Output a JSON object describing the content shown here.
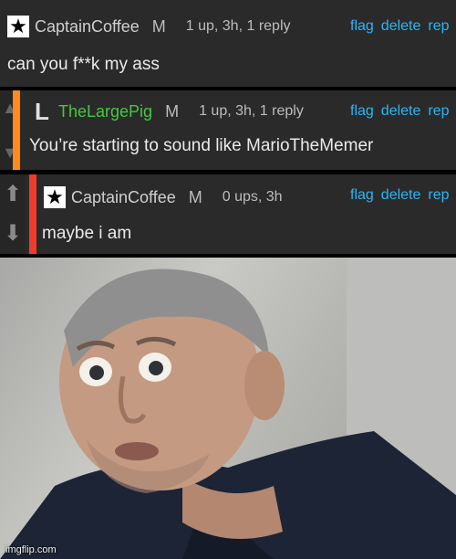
{
  "comments": [
    {
      "username": "CaptainCoffee",
      "badge": "M",
      "stats": "1 up, 3h, 1 reply",
      "text": "can you f**k my ass",
      "username_color": "#cfcfcf",
      "actions": [
        "flag",
        "delete",
        "rep"
      ]
    },
    {
      "username": "TheLargePig",
      "badge": "M",
      "stats": "1 up, 3h, 1 reply",
      "text": "You’re starting to sound like MarioTheMemer",
      "username_color": "#43c843",
      "accent_color": "#ff8c1a",
      "actions": [
        "flag",
        "delete",
        "rep"
      ]
    },
    {
      "username": "CaptainCoffee",
      "badge": "M",
      "stats": "0 ups, 3h",
      "text": "maybe i am",
      "username_color": "#cfcfcf",
      "accent_color": "#f03a2e",
      "actions": [
        "flag",
        "delete",
        "rep"
      ]
    }
  ],
  "watermark": "imgflip.com",
  "colors": {
    "link": "#29b6f6",
    "panel": "#2a2a2a"
  },
  "icons": {
    "star": "star-icon",
    "l_badge": "l-badge-icon",
    "up": "upvote-arrow-icon",
    "down": "downvote-arrow-icon"
  }
}
